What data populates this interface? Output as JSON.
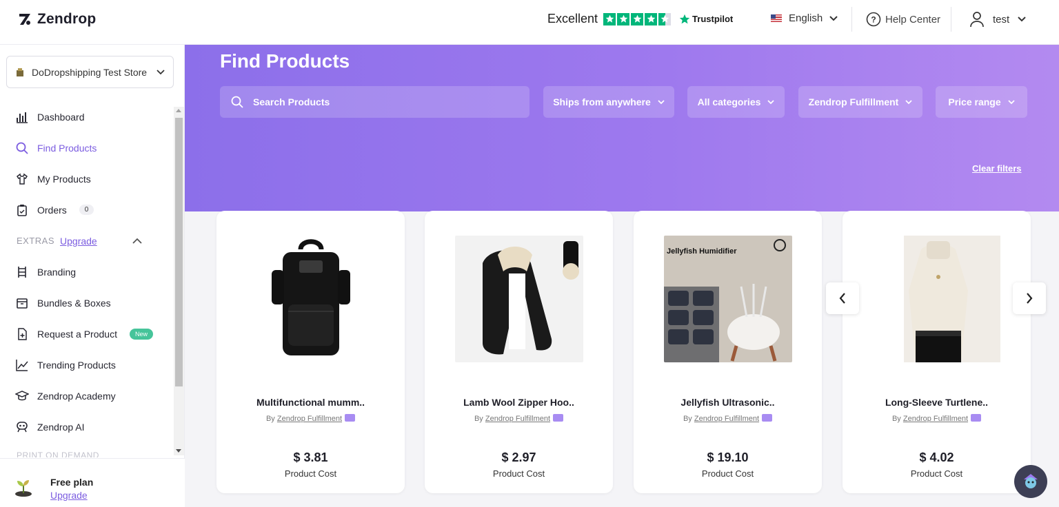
{
  "header": {
    "brand": "Zendrop",
    "trust_word": "Excellent",
    "trust_brand": "Trustpilot",
    "language": "English",
    "help": "Help Center",
    "user": "test"
  },
  "sidebar": {
    "store": "DoDropshipping Test Store",
    "items": [
      {
        "label": "Dashboard",
        "icon": "chart-icon"
      },
      {
        "label": "Find Products",
        "icon": "search-icon"
      },
      {
        "label": "My Products",
        "icon": "tshirt-icon"
      },
      {
        "label": "Orders",
        "icon": "clipboard-icon",
        "count": "0"
      }
    ],
    "extras_label": "EXTRAS",
    "extras_upgrade": "Upgrade",
    "extras_items": [
      {
        "label": "Branding",
        "icon": "branding-icon"
      },
      {
        "label": "Bundles & Boxes",
        "icon": "box-icon"
      },
      {
        "label": "Request a Product",
        "icon": "request-icon",
        "badge": "New"
      },
      {
        "label": "Trending Products",
        "icon": "trend-icon"
      },
      {
        "label": "Zendrop Academy",
        "icon": "academy-icon"
      },
      {
        "label": "Zendrop AI",
        "icon": "ai-icon"
      }
    ],
    "pod_label": "PRINT ON DEMAND",
    "plan_name": "Free plan",
    "plan_upgrade": "Upgrade"
  },
  "main": {
    "title": "Find Products",
    "search_placeholder": "Search Products",
    "filters": [
      "Ships from anywhere",
      "All categories",
      "Zendrop Fulfillment",
      "Price range"
    ],
    "clear_filters": "Clear filters",
    "cost_label": "Product Cost",
    "by_label": "By",
    "supplier": "Zendrop Fulfillment",
    "products": [
      {
        "name": "Multifunctional mumm..",
        "price": "$ 3.81"
      },
      {
        "name": "Lamb Wool Zipper Hoo..",
        "price": "$ 2.97"
      },
      {
        "name": "Jellyfish Ultrasonic..",
        "price": "$ 19.10",
        "image_text": "Jellyfish Humidifier"
      },
      {
        "name": "Long-Sleeve Turtlene..",
        "price": "$ 4.02"
      }
    ]
  },
  "colors": {
    "accent": "#7b5ce0",
    "hero_start": "#8c6fea",
    "hero_end": "#b38af0",
    "trustpilot": "#00b67a"
  }
}
